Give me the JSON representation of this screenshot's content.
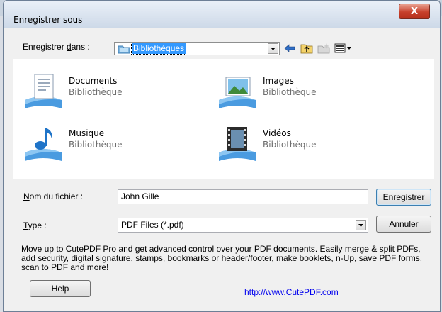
{
  "dialog": {
    "title": "Enregistrer sous",
    "close_glyph": "X"
  },
  "toolbar": {
    "save_in_label_prefix": "Enregistrer ",
    "save_in_label_accel": "d",
    "save_in_label_suffix": "ans :",
    "location": "Bibliothèques",
    "icons": [
      "back-arrow-icon",
      "up-folder-icon",
      "new-folder-icon",
      "view-menu-icon"
    ]
  },
  "libraries": [
    {
      "name": "Documents",
      "type": "Bibliothèque",
      "icon": "documents-library-icon"
    },
    {
      "name": "Images",
      "type": "Bibliothèque",
      "icon": "images-library-icon"
    },
    {
      "name": "Musique",
      "type": "Bibliothèque",
      "icon": "music-library-icon"
    },
    {
      "name": "Vidéos",
      "type": "Bibliothèque",
      "icon": "videos-library-icon"
    }
  ],
  "filename": {
    "label_accel": "N",
    "label_rest": "om du fichier :",
    "value": "John Gille"
  },
  "filetype": {
    "label_accel": "T",
    "label_rest": "ype :",
    "value": "PDF Files (*.pdf)"
  },
  "buttons": {
    "save_accel": "E",
    "save_rest": "nregistrer",
    "cancel": "Annuler",
    "help": "Help"
  },
  "info": {
    "text": "Move up to CutePDF Pro and get advanced control over your PDF documents. Easily merge & split PDFs, add security, digital signature, stamps, bookmarks or header/footer, make booklets, n-Up, save PDF forms, scan to PDF and more!",
    "link": "http://www.CutePDF.com"
  }
}
